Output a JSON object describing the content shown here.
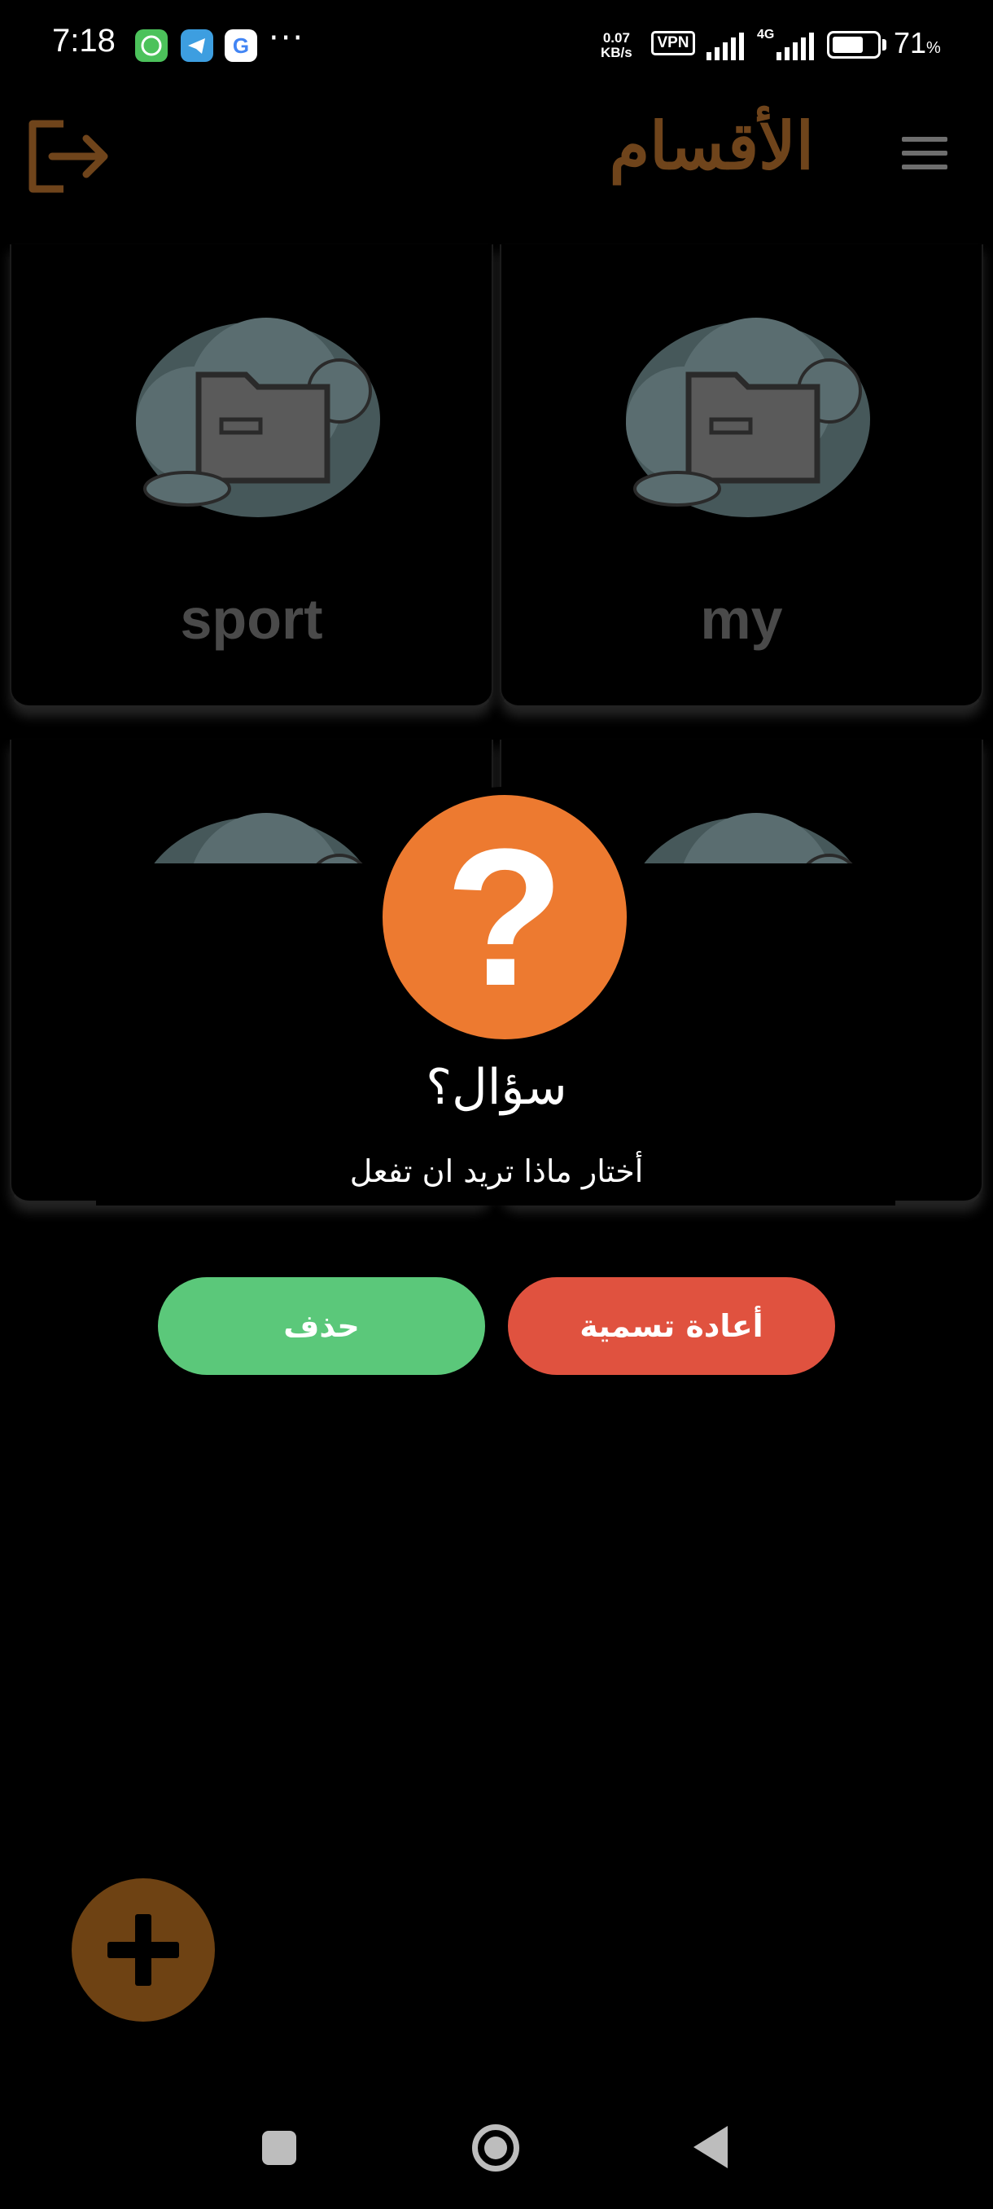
{
  "status_bar": {
    "time": "7:18",
    "net_speed_value": "0.07",
    "net_speed_unit": "KB/s",
    "vpn": "VPN",
    "network": "4G",
    "battery_percent": "71",
    "battery_symbol": "%",
    "battery_level": 0.71,
    "more": "···",
    "app_icons": [
      "whatsapp-icon",
      "telegram-icon",
      "google-icon"
    ]
  },
  "header": {
    "title": "الأقسام",
    "left_icon": "logout-icon",
    "right_icon": "menu-icon"
  },
  "categories": [
    {
      "label": "my"
    },
    {
      "label": "sport"
    },
    {
      "label": ""
    },
    {
      "label": ""
    }
  ],
  "dialog": {
    "icon": "question-icon",
    "icon_glyph": "?",
    "title": "سؤال؟",
    "message": "أختار ماذا تريد ان تفعل",
    "rename_button": "أعادة تسمية",
    "delete_button": "حذف"
  },
  "fab": {
    "icon": "plus-icon"
  },
  "colors": {
    "accent": "#6f441b",
    "question": "#ed7a30",
    "delete": "#5bc87a",
    "rename": "#e0523f"
  }
}
